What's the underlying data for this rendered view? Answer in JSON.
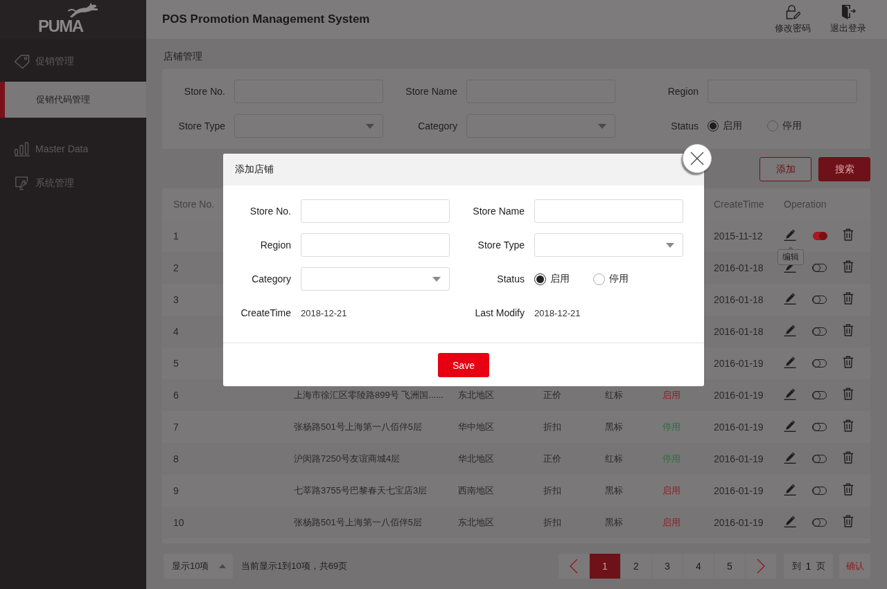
{
  "sidebar": {
    "logo": "PUMA",
    "items": [
      {
        "label": "促销管理",
        "selected": false,
        "children": [
          {
            "label": "促销代码管理",
            "selected": true
          }
        ]
      },
      {
        "label": "Master Data",
        "selected": false
      },
      {
        "label": "系统管理",
        "selected": false
      }
    ]
  },
  "header": {
    "title": "POS Promotion Management System",
    "actions": [
      {
        "label": "修改密码"
      },
      {
        "label": "退出登录"
      }
    ]
  },
  "page_title": "店铺管理",
  "filters": {
    "fields": [
      {
        "kind": "input",
        "label": "Store No."
      },
      {
        "kind": "input",
        "label": "Store Name"
      },
      {
        "kind": "input",
        "label": "Region"
      },
      {
        "kind": "select",
        "label": "Store Type"
      },
      {
        "kind": "select",
        "label": "Category"
      },
      {
        "kind": "radio",
        "label": "Status",
        "options": [
          {
            "label": "启用",
            "selected": true
          },
          {
            "label": "停用",
            "selected": false
          }
        ]
      }
    ]
  },
  "toolbar": [
    {
      "label": "添加",
      "kind": "outline"
    },
    {
      "label": "搜索",
      "kind": "primary"
    }
  ],
  "table": {
    "columns": {
      "store_no": "Store No.",
      "create_time": "CreateTime",
      "operation": "Operation"
    },
    "rows": [
      {
        "store_no": "1",
        "create_time": "2015-11-12",
        "switch_on": true,
        "tooltip": "编辑"
      },
      {
        "store_no": "2",
        "create_time": "2016-01-18",
        "switch_on": false
      },
      {
        "store_no": "3",
        "create_time": "2016-01-18",
        "switch_on": false
      },
      {
        "store_no": "4",
        "create_time": "2016-01-18",
        "switch_on": false
      },
      {
        "store_no": "5",
        "create_time": "2016-01-19",
        "switch_on": false
      },
      {
        "store_no": "6",
        "column_2": "上海市徐汇区零陵路899号 飞洲国......",
        "column_3": "东北地区",
        "column_4": "正价",
        "column_5": "红标",
        "column_6": {
          "text": "启用",
          "color": "#8f1b1f"
        },
        "create_time": "2016-01-19",
        "switch_on": false
      },
      {
        "store_no": "7",
        "column_2": "张杨路501号上海第一八佰伴5层",
        "column_3": "华中地区",
        "column_4": "折扣",
        "column_5": "黑标",
        "column_6": {
          "text": "停用",
          "color": "#2f6e43"
        },
        "create_time": "2016-01-19",
        "switch_on": false
      },
      {
        "store_no": "8",
        "column_2": "沪闵路7250号友谊商城4层",
        "column_3": "华北地区",
        "column_4": "正价",
        "column_5": "红标",
        "column_6": {
          "text": "停用",
          "color": "#2f6e43"
        },
        "create_time": "2016-01-19",
        "switch_on": false
      },
      {
        "store_no": "9",
        "column_2": "七莘路3755号巴黎春天七宝店3层",
        "column_3": "西南地区",
        "column_4": "折扣",
        "column_5": "黑标",
        "column_6": {
          "text": "启用",
          "color": "#8f1b1f"
        },
        "create_time": "2016-01-19",
        "switch_on": false
      },
      {
        "store_no": "10",
        "column_2": "张杨路501号上海第一八佰伴5层",
        "column_3": "东北地区",
        "column_4": "折扣",
        "column_5": "黑标",
        "column_6": {
          "text": "启用",
          "color": "#8f1b1f"
        },
        "create_time": "2016-01-19",
        "switch_on": false
      }
    ]
  },
  "pagination": {
    "page_size": "显示10项",
    "summary": "当前显示1到10项，共69页",
    "pages": [
      {
        "label": "1",
        "selected": true
      },
      {
        "label": "2",
        "selected": false
      },
      {
        "label": "3",
        "selected": false
      },
      {
        "label": "4",
        "selected": false
      },
      {
        "label": "5",
        "selected": false
      }
    ],
    "goto": {
      "prefix": "到",
      "value": "1",
      "suffix": "页"
    },
    "confirm": "确认"
  },
  "modal": {
    "title": "添加店铺",
    "fields": [
      {
        "kind": "input",
        "label": "Store No."
      },
      {
        "kind": "input",
        "label": "Store Name"
      },
      {
        "kind": "input",
        "label": "Region"
      },
      {
        "kind": "select",
        "label": "Store Type"
      },
      {
        "kind": "select",
        "label": "Category"
      },
      {
        "kind": "radio",
        "label": "Status",
        "options": [
          {
            "label": "启用",
            "selected": true
          },
          {
            "label": "停用",
            "selected": false
          }
        ]
      },
      {
        "kind": "text",
        "label": "CreateTime",
        "value": "2018-12-21"
      },
      {
        "kind": "text",
        "label": "Last Modify",
        "value": "2018-12-21"
      }
    ],
    "save": "Save"
  }
}
